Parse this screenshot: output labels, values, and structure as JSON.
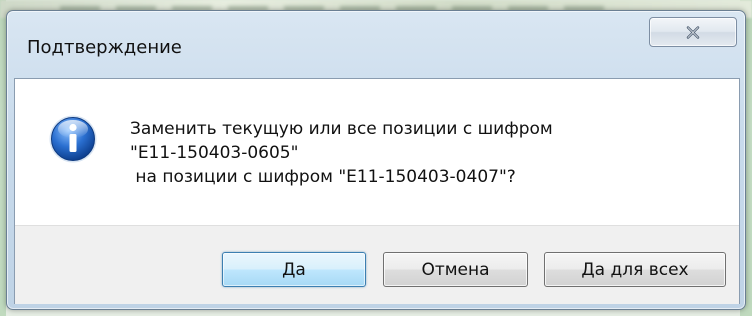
{
  "window": {
    "title": "Подтверждение"
  },
  "message": {
    "icon": "info-icon",
    "text": "Заменить текущую или все позиции с шифром\n\"E11-150403-0605\"\n на позиции с шифром \"E11-150403-0407\"?"
  },
  "buttons": {
    "yes": "Да",
    "cancel": "Отмена",
    "yes_all": "Да для всех"
  },
  "colors": {
    "info_icon": "#2a6fd0",
    "default_button_border": "#3c7fb1"
  }
}
